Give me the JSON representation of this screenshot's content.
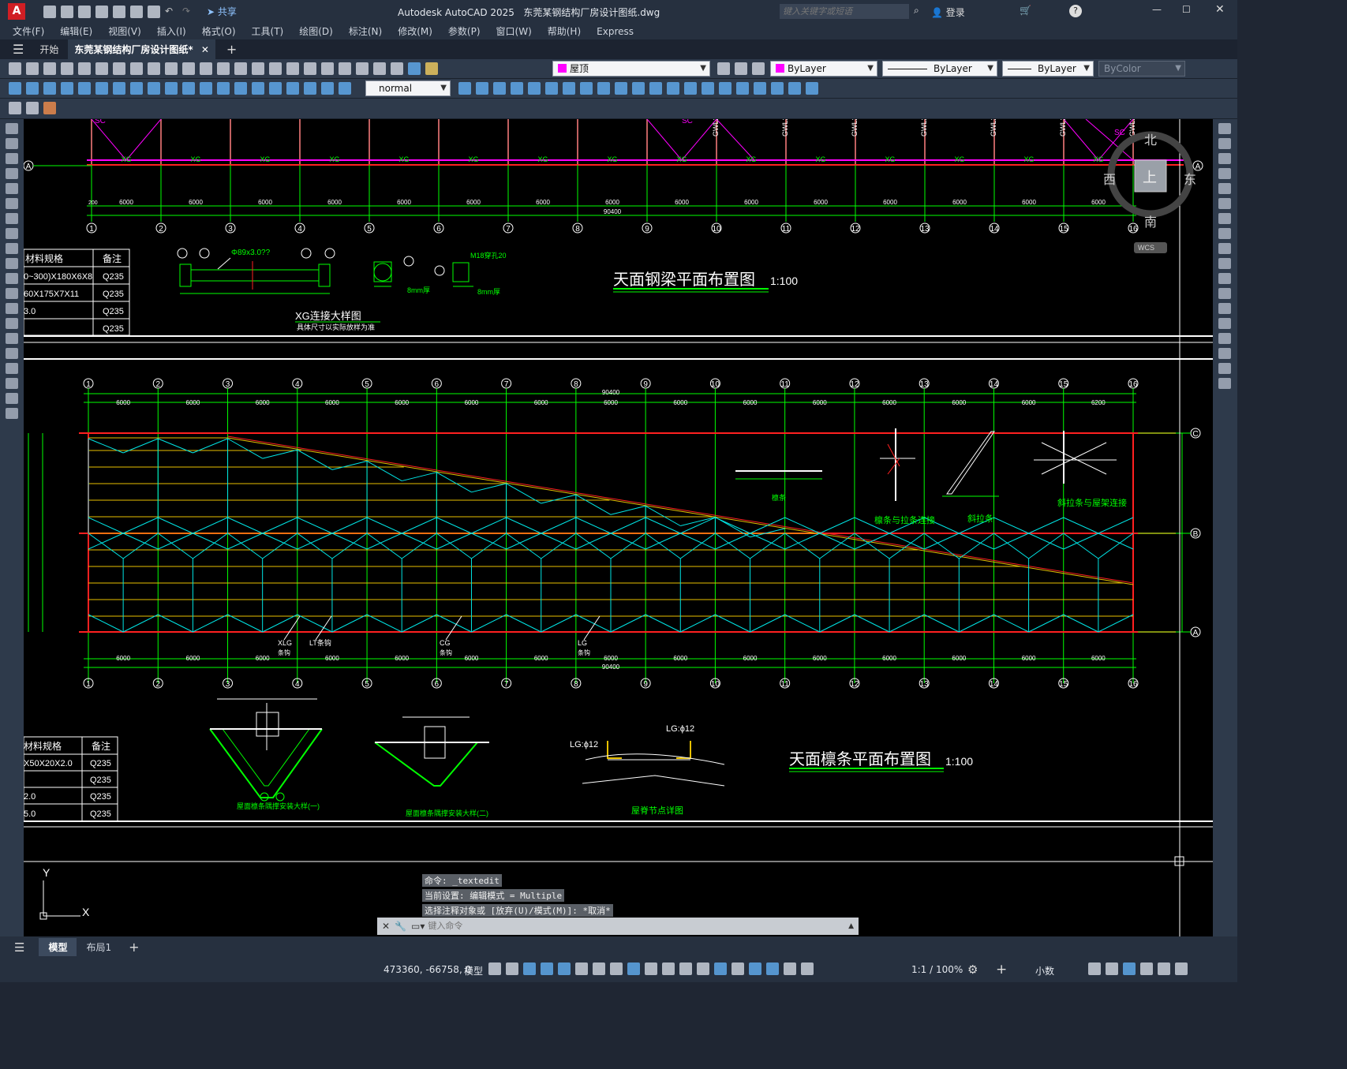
{
  "app": {
    "title": "Autodesk AutoCAD 2025",
    "file": "东莞某钢结构厂房设计图纸.dwg",
    "search_placeholder": "键入关键字或短语",
    "login": "登录",
    "share": "共享"
  },
  "menu": [
    "文件(F)",
    "编辑(E)",
    "视图(V)",
    "插入(I)",
    "格式(O)",
    "工具(T)",
    "绘图(D)",
    "标注(N)",
    "修改(M)",
    "参数(P)",
    "窗口(W)",
    "帮助(H)",
    "Express"
  ],
  "tabs": {
    "start": "开始",
    "doc": "东莞某钢结构厂房设计图纸*"
  },
  "toolbar": {
    "layer": "屋顶",
    "color": "ByLayer",
    "linetype": "ByLayer",
    "lineweight": "ByLayer",
    "plotstyle": "ByColor",
    "textstyle": "normal"
  },
  "viewcube": {
    "north": "北",
    "south": "南",
    "east": "东",
    "west": "西",
    "top": "上",
    "wcs": "WCS"
  },
  "drawing": {
    "title1": "天面钢梁平面布置图",
    "title2": "天面檩条平面布置图",
    "scale": "1:100",
    "xg_title": "XG连接大样图",
    "xg_note": "具体尺寸以实际放样为准",
    "xg_pipe": "Φ89x3.0??",
    "bolt": "M18穿孔20",
    "plate": "8mm厚",
    "table_head": [
      "材料规格",
      "备注"
    ],
    "table1": [
      [
        "0~300)X180X6X8",
        "Q235"
      ],
      [
        "60X175X7X11",
        "Q235"
      ],
      [
        "3.0",
        "Q235"
      ],
      [
        "",
        "Q235"
      ]
    ],
    "table2": [
      [
        "X50X20X2.0",
        "Q235"
      ],
      [
        "",
        "Q235"
      ],
      [
        "2.0",
        "Q235"
      ],
      [
        "5.0",
        "Q235"
      ]
    ],
    "grid_nums": [
      "1",
      "2",
      "3",
      "4",
      "5",
      "6",
      "7",
      "8",
      "9",
      "10",
      "11",
      "12",
      "13",
      "14",
      "15",
      "16"
    ],
    "dims": [
      "6000",
      "6000",
      "6000",
      "6000",
      "6000",
      "6000",
      "6000",
      "6000",
      "6000",
      "6000",
      "6000",
      "6000",
      "6000",
      "6000",
      "6000"
    ],
    "dim_last": "6200",
    "total": "90400",
    "edge": "200",
    "row_labels": [
      "A",
      "B",
      "C"
    ],
    "upper_labels": [
      "SC",
      "SC",
      "SC",
      "GWL2a",
      "GWL2",
      "GWL2",
      "GWL2",
      "GWL2",
      "GWL2",
      "GWL2"
    ],
    "xg": "XG",
    "purlin_labels": [
      "XLG",
      "LT条钩",
      "CG",
      "LG"
    ],
    "purlin_sub": "条钩",
    "detail_labels": [
      "檩条与拉条连接",
      "斜拉条",
      "斜拉条与屋架连接",
      "檩条",
      "屋面檩条隅撑安装大样(一)",
      "屋面檩条隅撑安装大样(二)",
      "屋脊节点详图"
    ],
    "lg12": "LG:ϕ12"
  },
  "command": {
    "history": [
      "命令: _textedit",
      "当前设置: 编辑模式 = Multiple",
      "选择注释对象或 [放弃(U)/模式(M)]: *取消*"
    ],
    "placeholder": "键入命令"
  },
  "layouts": {
    "model": "模型",
    "layout1": "布局1"
  },
  "status": {
    "coords": "473360, -66758, 0",
    "model": "模型",
    "scale": "1:1 / 100%",
    "units": "小数"
  },
  "colors": {
    "grid": "#00ff00",
    "red": "#ff2020",
    "cyan": "#00e5e5",
    "yellow": "#e8c000",
    "magenta": "#ff00ff",
    "white": "#ffffff"
  }
}
